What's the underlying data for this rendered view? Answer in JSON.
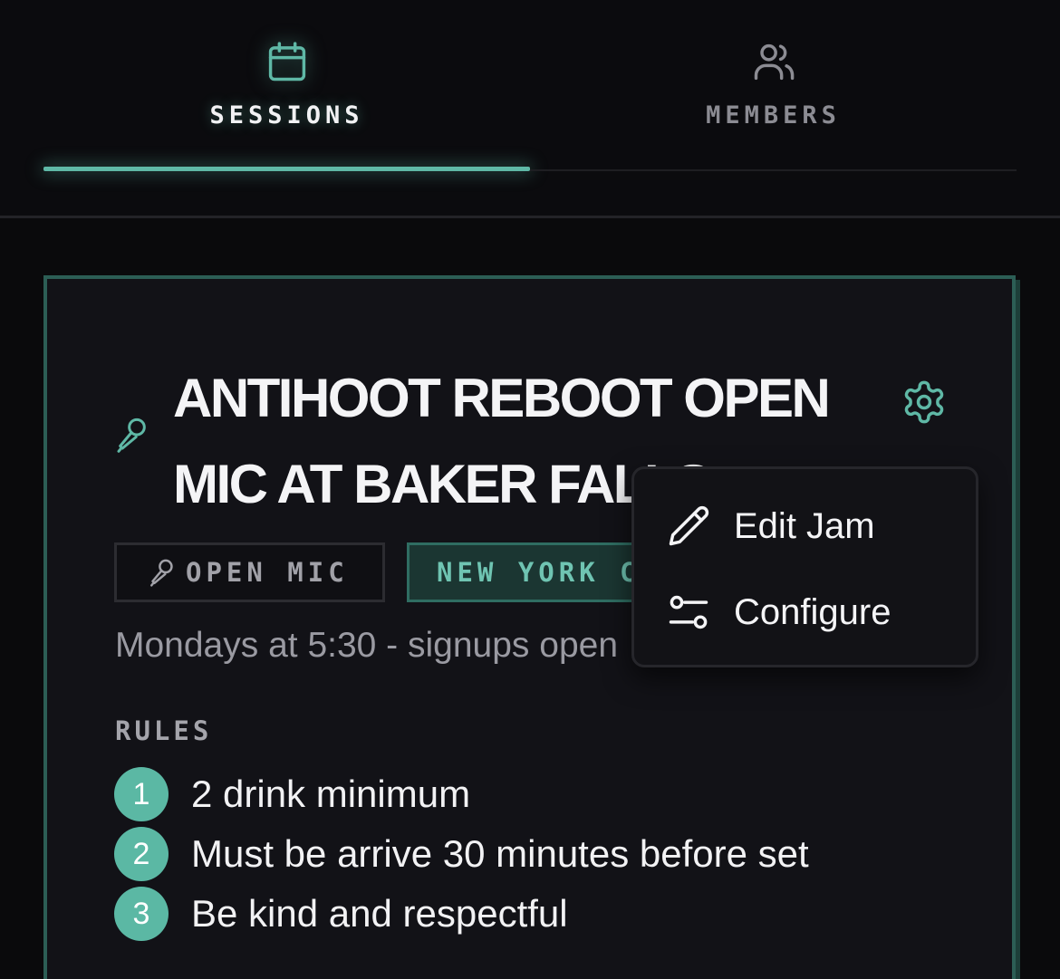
{
  "tabs": [
    {
      "label": "SESSIONS",
      "icon": "calendar-icon",
      "active": true
    },
    {
      "label": "MEMBERS",
      "icon": "users-icon",
      "active": false
    }
  ],
  "jam": {
    "title": "ANTIHOOT REBOOT OPEN MIC AT BAKER FALLS",
    "title_icon": "microphone-icon",
    "settings_icon": "gear-icon",
    "tags": [
      {
        "label": "OPEN MIC",
        "icon": "microphone-icon"
      },
      {
        "label": "NEW YORK CITY"
      }
    ],
    "schedule": "Mondays at 5:30 - signups open",
    "rules_heading": "RULES",
    "rules": [
      {
        "number": "1",
        "text": "2 drink minimum"
      },
      {
        "number": "2",
        "text": "Must be arrive 30 minutes before set"
      },
      {
        "number": "3",
        "text": "Be kind and respectful"
      }
    ]
  },
  "menu": {
    "items": [
      {
        "label": "Edit Jam",
        "icon": "pencil-icon"
      },
      {
        "label": "Configure",
        "icon": "sliders-icon"
      }
    ]
  },
  "colors": {
    "accent": "#5fb8a6",
    "background": "#0a0a0c",
    "card": "#121217",
    "card_border": "#2c5e55",
    "text_primary": "#f4f4f6",
    "text_muted": "#9a9aa2"
  }
}
